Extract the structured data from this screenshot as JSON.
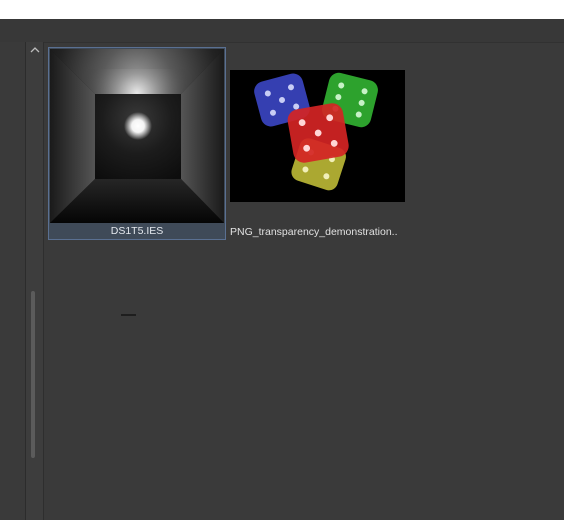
{
  "file_browser": {
    "items": [
      {
        "name": "DS1T5.IES",
        "type": "ies-light-profile",
        "selected": true
      },
      {
        "name": "PNG_transparency_demonstration..",
        "type": "png-image",
        "selected": false
      }
    ]
  },
  "scrollbar": {
    "up_arrow": "⌃"
  },
  "colors": {
    "selection_fill": "#3f4a58",
    "selection_border": "#5a7092",
    "background": "#3a3a3a"
  }
}
